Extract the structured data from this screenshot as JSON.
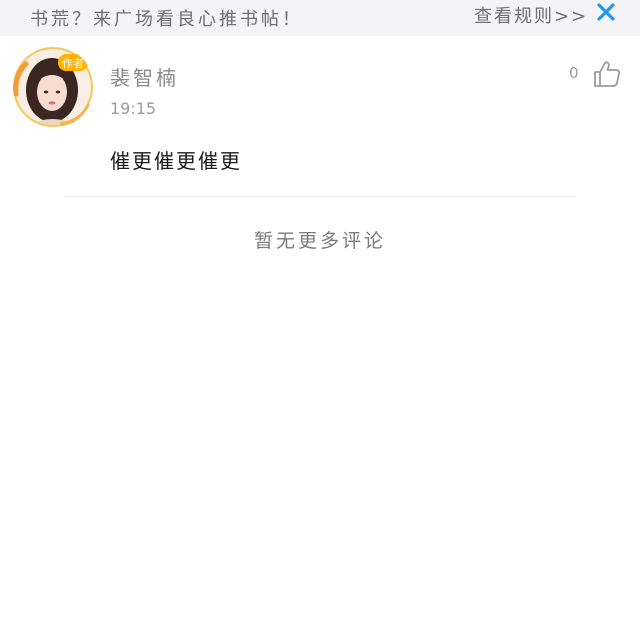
{
  "notice": {
    "text": "书荒？来广场看良心推书帖！",
    "rules_link": "查看规则>>",
    "close_icon": "close-icon",
    "accent_color": "#2196f3"
  },
  "comment": {
    "avatar_badge": "作者",
    "author_name": "裴智楠",
    "time": "19:15",
    "like_count": "0",
    "like_icon": "thumbs-up-icon",
    "body": "催更催更催更"
  },
  "footer": {
    "no_more_text": "暂无更多评论"
  }
}
